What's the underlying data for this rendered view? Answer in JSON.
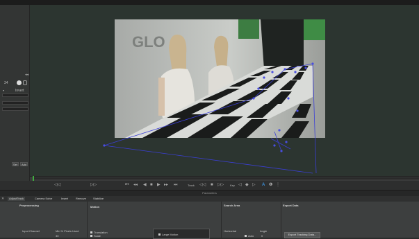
{
  "left_panel": {
    "input_value": "34",
    "invert_label": "Invert",
    "set_label": "Set",
    "add_label": "Add"
  },
  "transport": {
    "track_label": "Track",
    "key_label": "Key"
  },
  "parameters": {
    "header": "Parameters",
    "tabs": [
      "AdjustTrack",
      "Camera Solve",
      "Insert",
      "Remove",
      "Stabilize"
    ],
    "active_tab": 0,
    "sections": {
      "preprocessing": "Preprocessing",
      "motion": "Motion",
      "search_area": "Search Area",
      "export_data": "Export Data"
    },
    "input_channel_label": "Input Channel",
    "min_pixels_label": "Min % Pixels Used",
    "min_pixels_value": "30",
    "translation_label": "Translation",
    "scale_label": "Scale",
    "large_motion_label": "Large Motion",
    "horizontal_label": "Horizontal",
    "angle_label": "Angle",
    "auto_label": "Auto",
    "auto_value": "0",
    "export_button": "Export Tracking Data..."
  },
  "colors": {
    "track_points": "#3b3fd6",
    "playhead": "#3fae3f"
  }
}
